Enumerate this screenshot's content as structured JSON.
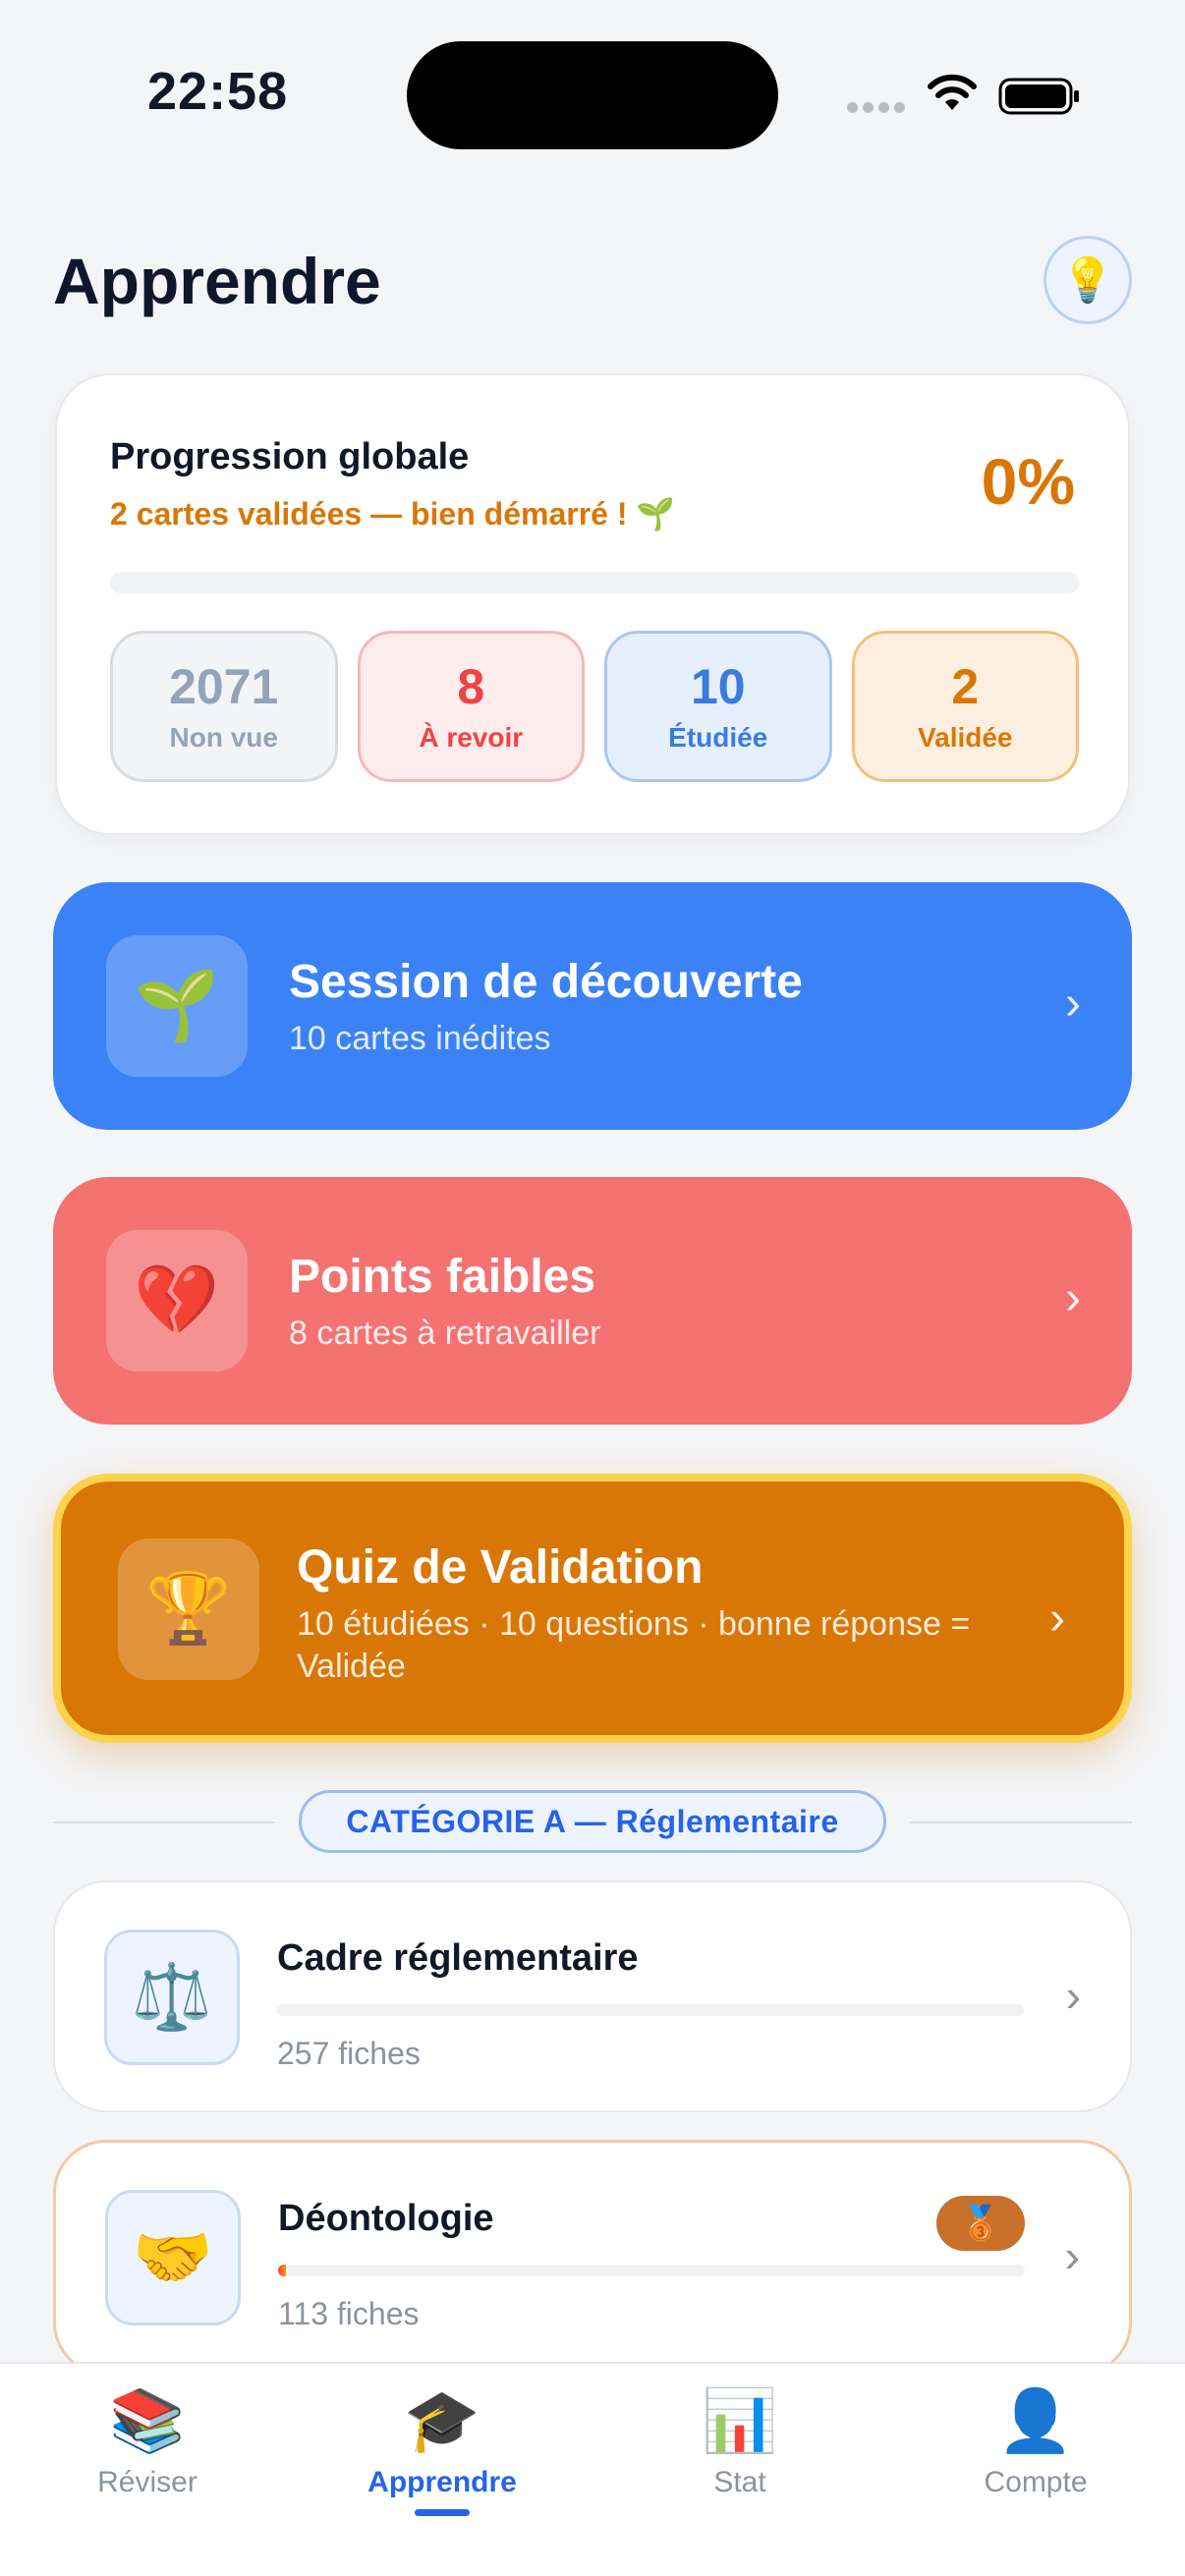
{
  "status_bar": {
    "time": "22:58"
  },
  "header": {
    "title": "Apprendre",
    "tip_icon": "💡"
  },
  "progress": {
    "title": "Progression globale",
    "subtitle": "2 cartes validées — bien démarré ! 🌱",
    "percent_label": "0%",
    "percent_value": 0.0,
    "stats": [
      {
        "value": "2071",
        "label": "Non vue",
        "color": "#94a3b8"
      },
      {
        "value": "8",
        "label": "À revoir",
        "color": "#ef4444"
      },
      {
        "value": "10",
        "label": "Étudiée",
        "color": "#3b7be0"
      },
      {
        "value": "2",
        "label": "Validée",
        "color": "#d97706"
      }
    ]
  },
  "actions": {
    "discover": {
      "icon": "🌱",
      "title": "Session de découverte",
      "subtitle": "10 cartes inédites",
      "color": "#3b82f6"
    },
    "weak": {
      "icon": "💔",
      "title": "Points faibles",
      "subtitle": "8 cartes à retravailler",
      "color": "#f47272"
    },
    "quiz": {
      "icon": "🏆",
      "title": "Quiz de Validation",
      "subtitle": "10 étudiées · 10 questions · bonne réponse = Validée",
      "color": "#d97706"
    }
  },
  "category": {
    "label": "CATÉGORIE A — Réglementaire"
  },
  "items": [
    {
      "icon": "⚖️",
      "name": "Cadre réglementaire",
      "count": "257 fiches",
      "progress": 0.0
    },
    {
      "icon": "🤝",
      "name": "Déontologie",
      "count": "113 fiches",
      "progress": 0.01,
      "badge": "🥉"
    }
  ],
  "tabs": [
    {
      "icon": "📚",
      "label": "Réviser"
    },
    {
      "icon": "🎓",
      "label": "Apprendre"
    },
    {
      "icon": "📊",
      "label": "Stat"
    },
    {
      "icon": "👤",
      "label": "Compte"
    }
  ],
  "accent_color": "#2563eb"
}
